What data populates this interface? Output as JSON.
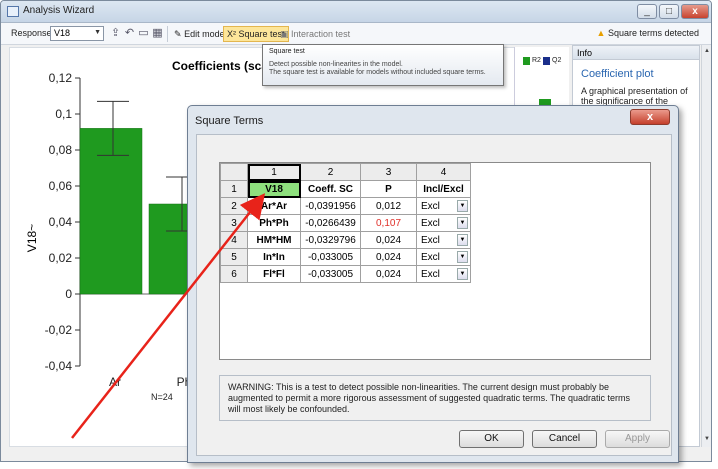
{
  "window": {
    "title": "Analysis Wizard",
    "controls": [
      "_",
      "□",
      "x"
    ]
  },
  "toolbar": {
    "response_label": "Response:",
    "response_value": "V18",
    "edit_model": "Edit model",
    "square_test": "Square test",
    "interaction_test": "Interaction test",
    "status": "Square terms detected"
  },
  "tooltip": {
    "title": "Square test",
    "line1": "Detect possible non-linearites in the model.",
    "line2": "The square test is available for models without included square terms."
  },
  "chart_data": {
    "type": "bar",
    "title": "Coefficients (scal",
    "ylabel": "V18~",
    "categories": [
      "Ar",
      "Ph"
    ],
    "values": [
      0.092,
      0.05
    ],
    "error_upper": [
      0.107,
      0.065
    ],
    "error_lower": [
      0.077,
      0.035
    ],
    "ylim": [
      -0.04,
      0.12
    ],
    "yticks": [
      "0,12",
      "0,1",
      "0,08",
      "0,06",
      "0,04",
      "0,02",
      "0",
      "-0,02",
      "-0,04"
    ],
    "footer": "N=24",
    "bar_color": "#1f9a1f"
  },
  "legend": {
    "items": [
      {
        "label": "R2",
        "color": "#1f9a1f"
      },
      {
        "label": "Q2",
        "color": "#1a2e8a"
      }
    ]
  },
  "info": {
    "header": "Info",
    "title": "Coefficient plot",
    "body": "A graphical presentation of the significance of the model terms."
  },
  "dialog": {
    "title": "Square Terms",
    "col_numbers": [
      "1",
      "2",
      "3",
      "4"
    ],
    "headers": [
      "V18",
      "Coeff. SC",
      "P",
      "Incl/Excl"
    ],
    "rows": [
      {
        "n": "2",
        "term": "Ar*Ar",
        "coeff": "-0,0391956",
        "p": "0,012",
        "incl": "Excl"
      },
      {
        "n": "3",
        "term": "Ph*Ph",
        "coeff": "-0,0266439",
        "p": "0,107",
        "incl": "Excl"
      },
      {
        "n": "4",
        "term": "HM*HM",
        "coeff": "-0,0329796",
        "p": "0,024",
        "incl": "Excl"
      },
      {
        "n": "5",
        "term": "In*In",
        "coeff": "-0,033005",
        "p": "0,024",
        "incl": "Excl"
      },
      {
        "n": "6",
        "term": "Fl*Fl",
        "coeff": "-0,033005",
        "p": "0,024",
        "incl": "Excl"
      }
    ],
    "header_row_n": "1",
    "warning": "WARNING: This is a test to detect possible non-linearities. The current design must probably be augmented to permit a more rigorous assessment of suggested quadratic terms. The quadratic terms will most likely be confounded.",
    "ok": "OK",
    "cancel": "Cancel",
    "apply": "Apply",
    "close": "x"
  },
  "colors": {
    "accent_red": "#e0302a",
    "highlight_green": "#8ee07d",
    "arrow": "#e8231a"
  }
}
